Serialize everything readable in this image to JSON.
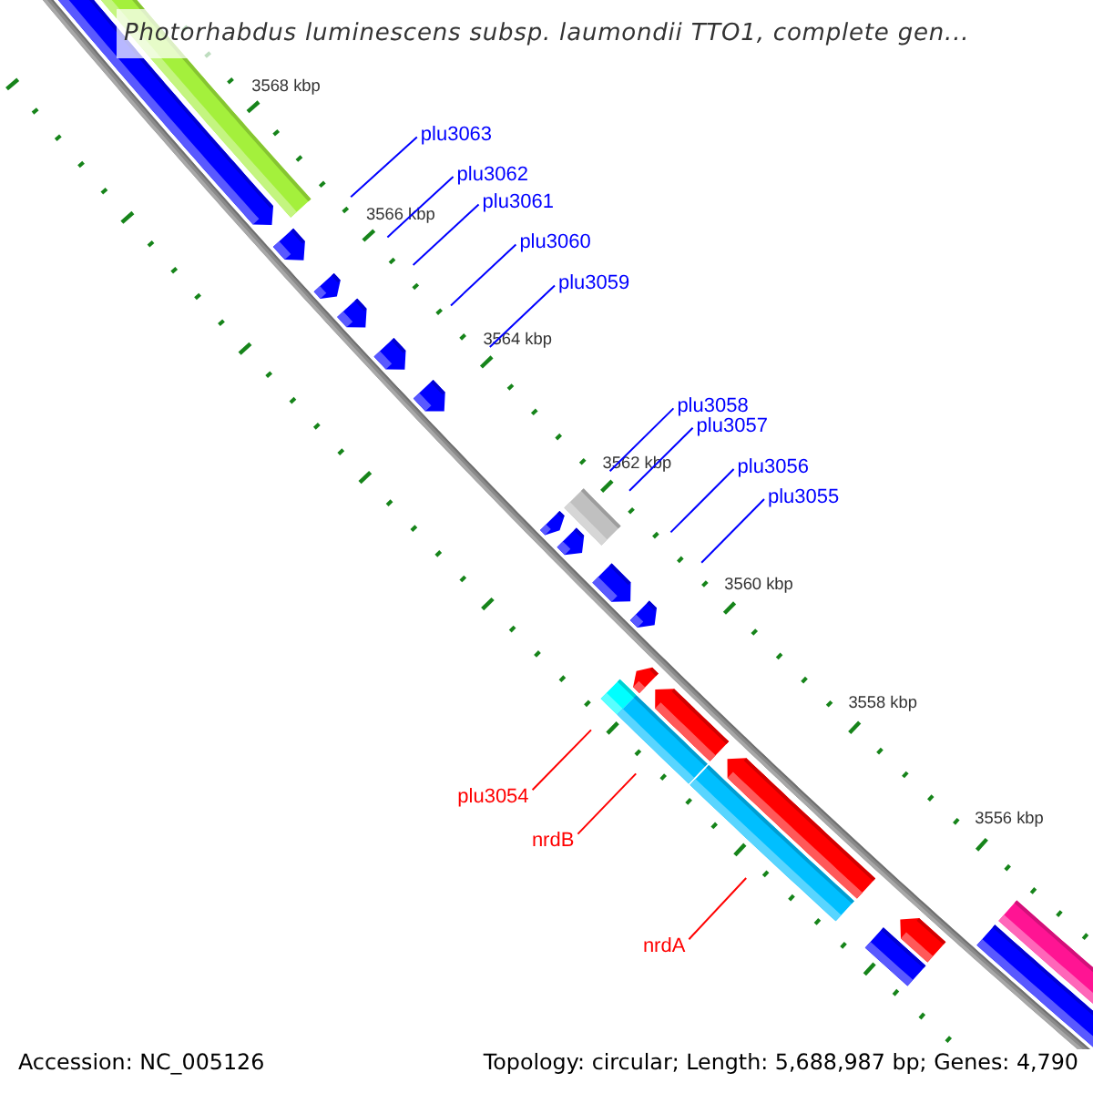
{
  "title": "Photorhabdus luminescens subsp. laumondii TTO1, complete gen...",
  "ruler": {
    "labels": [
      "3568 kbp",
      "3566 kbp",
      "3564 kbp",
      "3562 kbp",
      "3560 kbp",
      "3558 kbp",
      "3556 kbp"
    ]
  },
  "features": [
    {
      "kind": "gene",
      "reverse": true,
      "color": "#0000ff"
    },
    {
      "kind": "block",
      "color": "#a4f03c"
    },
    {
      "kind": "gene",
      "reverse": true,
      "color": "#0000ff",
      "label": "plu3063"
    },
    {
      "kind": "gene",
      "reverse": true,
      "color": "#0000ff",
      "label": "plu3062"
    },
    {
      "kind": "gene",
      "reverse": true,
      "color": "#0000ff",
      "label": "plu3061"
    },
    {
      "kind": "gene",
      "reverse": true,
      "color": "#0000ff",
      "label": "plu3060"
    },
    {
      "kind": "gene",
      "reverse": true,
      "color": "#0000ff",
      "label": "plu3059"
    },
    {
      "kind": "gene",
      "reverse": true,
      "color": "#0000ff",
      "label": "plu3058"
    },
    {
      "kind": "block",
      "color": "#c0c0c0"
    },
    {
      "kind": "gene",
      "reverse": true,
      "color": "#0000ff",
      "label": "plu3057"
    },
    {
      "kind": "gene",
      "reverse": true,
      "color": "#0000ff",
      "label": "plu3056"
    },
    {
      "kind": "gene",
      "reverse": true,
      "color": "#0000ff",
      "label": "plu3055"
    },
    {
      "kind": "block",
      "color": "#00ffff"
    },
    {
      "kind": "gene",
      "reverse": false,
      "color": "#ff0000",
      "label": "plu3054"
    },
    {
      "kind": "block",
      "color": "#00bfff"
    },
    {
      "kind": "gene",
      "reverse": false,
      "color": "#ff0000",
      "label": "nrdB"
    },
    {
      "kind": "block",
      "color": "#00bfff"
    },
    {
      "kind": "gene",
      "reverse": false,
      "color": "#ff0000",
      "label": "nrdA"
    },
    {
      "kind": "gene",
      "reverse": false,
      "color": "#ff0000"
    },
    {
      "kind": "block",
      "color": "#0000ff"
    },
    {
      "kind": "block",
      "color": "#ff1493"
    },
    {
      "kind": "gene",
      "reverse": true,
      "color": "#0000ff"
    }
  ],
  "footer": {
    "accession": "Accession: NC_005126",
    "summary": "Topology: circular; Length: 5,688,987 bp; Genes: 4,790"
  }
}
